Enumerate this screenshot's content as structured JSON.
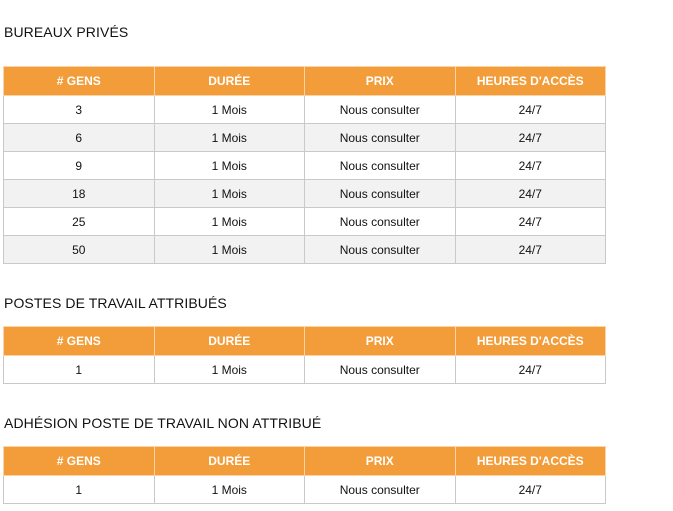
{
  "columns": [
    "# GENS",
    "DURÉE",
    "PRIX",
    "HEURES D'ACCÈS"
  ],
  "sections": [
    {
      "title": "BUREAUX PRIVÉS",
      "rows": [
        [
          "3",
          "1 Mois",
          "Nous consulter",
          "24/7"
        ],
        [
          "6",
          "1 Mois",
          "Nous consulter",
          "24/7"
        ],
        [
          "9",
          "1 Mois",
          "Nous consulter",
          "24/7"
        ],
        [
          "18",
          "1 Mois",
          "Nous consulter",
          "24/7"
        ],
        [
          "25",
          "1 Mois",
          "Nous consulter",
          "24/7"
        ],
        [
          "50",
          "1 Mois",
          "Nous consulter",
          "24/7"
        ]
      ]
    },
    {
      "title": "POSTES DE TRAVAIL ATTRIBUÉS",
      "rows": [
        [
          "1",
          "1 Mois",
          "Nous consulter",
          "24/7"
        ]
      ]
    },
    {
      "title": "ADHÉSION POSTE DE TRAVAIL NON ATTRIBUÉ",
      "rows": [
        [
          "1",
          "1 Mois",
          "Nous consulter",
          "24/7"
        ]
      ]
    }
  ],
  "colors": {
    "header_bg": "#f29d3a",
    "header_text": "#ffffff",
    "row_alt": "#f2f2f2"
  }
}
